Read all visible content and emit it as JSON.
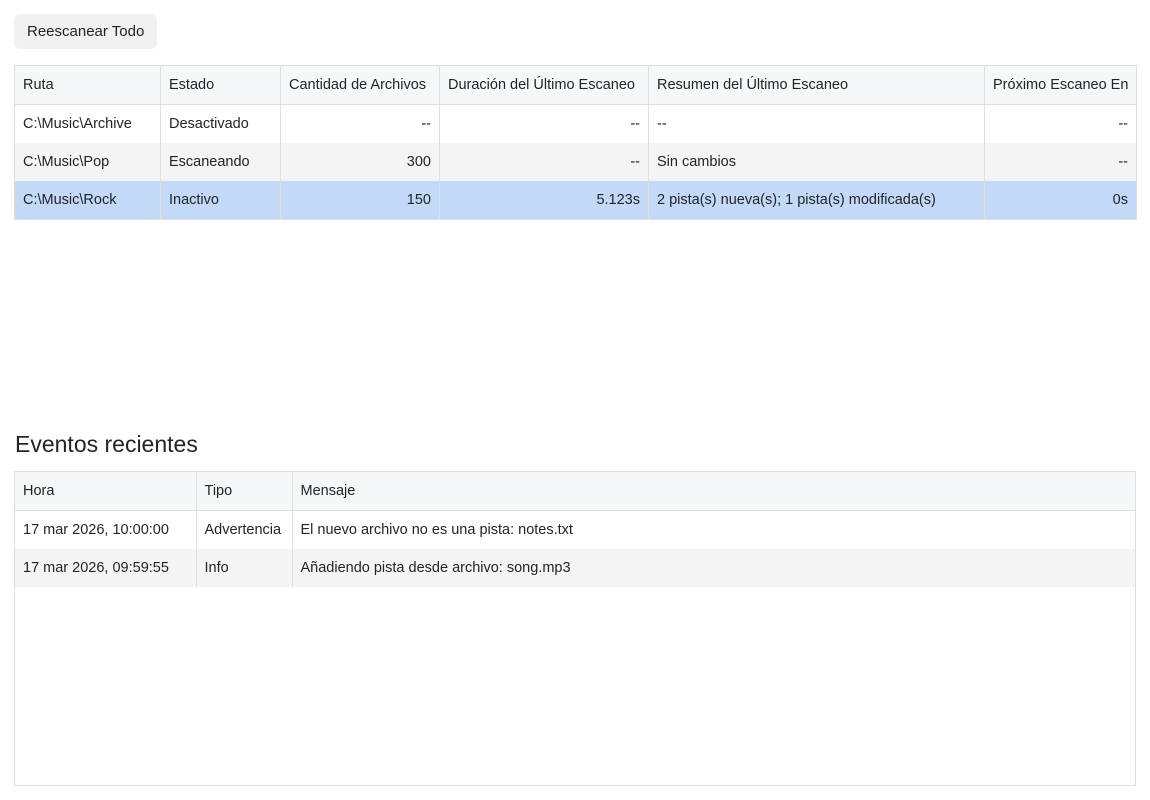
{
  "toolbar": {
    "rescan_all_label": "Reescanear Todo"
  },
  "folders": {
    "headers": {
      "path": "Ruta",
      "status": "Estado",
      "file_count": "Cantidad de Archivos",
      "last_scan_duration": "Duración del Último Escaneo",
      "last_scan_summary": "Resumen del Último Escaneo",
      "next_scan_in": "Próximo Escaneo En"
    },
    "rows": [
      {
        "path": "C:\\Music\\Archive",
        "status": "Desactivado",
        "file_count": "--",
        "last_scan_duration": "--",
        "last_scan_summary": "--",
        "next_scan_in": "--",
        "selected": false
      },
      {
        "path": "C:\\Music\\Pop",
        "status": "Escaneando",
        "file_count": "300",
        "last_scan_duration": "--",
        "last_scan_summary": "Sin cambios",
        "next_scan_in": "--",
        "selected": false
      },
      {
        "path": "C:\\Music\\Rock",
        "status": "Inactivo",
        "file_count": "150",
        "last_scan_duration": "5.123s",
        "last_scan_summary": "2 pista(s) nueva(s); 1 pista(s) modificada(s)",
        "next_scan_in": "0s",
        "selected": true
      }
    ]
  },
  "events": {
    "title": "Eventos recientes",
    "headers": {
      "time": "Hora",
      "type": "Tipo",
      "message": "Mensaje"
    },
    "rows": [
      {
        "time": "17 mar 2026, 10:00:00",
        "type": "Advertencia",
        "message": "El nuevo archivo no es una pista: notes.txt"
      },
      {
        "time": "17 mar 2026, 09:59:55",
        "type": "Info",
        "message": "Añadiendo pista desde archivo: song.mp3"
      }
    ]
  },
  "colors": {
    "selected_row": "#c2daf8",
    "alt_row": "#f4f4f4",
    "header_bg": "#f6f7f8",
    "border": "#dcdee0"
  }
}
